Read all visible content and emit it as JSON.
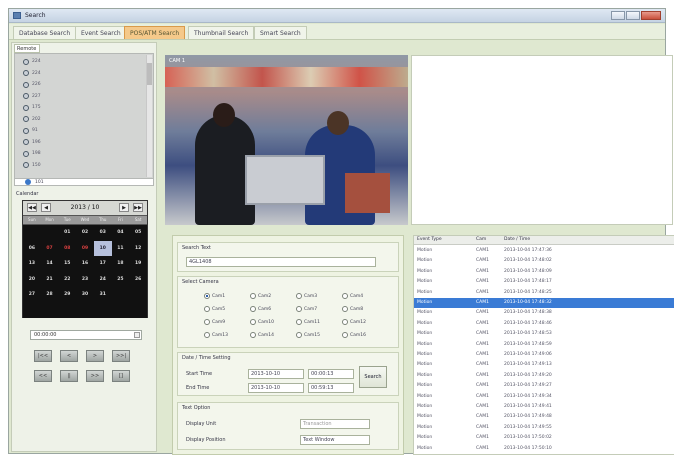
{
  "window": {
    "title": "Search"
  },
  "tabs": [
    {
      "label": "Database Search",
      "active": false
    },
    {
      "label": "Event Search",
      "active": false
    },
    {
      "label": "POS/ATM Search",
      "active": true
    },
    {
      "label": "Thumbnail Search",
      "active": false
    },
    {
      "label": "Smart Search",
      "active": false
    }
  ],
  "device_tab": "Remote",
  "devices": [
    "224",
    "224",
    "226",
    "227",
    "175",
    "202",
    "91",
    "196",
    "198",
    "150"
  ],
  "device_selected": "101",
  "calendar": {
    "label": "Calendar",
    "month": "2013 / 10",
    "weekdays": [
      "Sun",
      "Mon",
      "Tue",
      "Wed",
      "Thu",
      "Fri",
      "Sat"
    ],
    "days": [
      "",
      "",
      "01",
      "02",
      "03",
      "04",
      "05",
      "06",
      "07",
      "08",
      "09",
      "10",
      "11",
      "12",
      "13",
      "14",
      "15",
      "16",
      "17",
      "18",
      "19",
      "20",
      "21",
      "22",
      "23",
      "24",
      "25",
      "26",
      "27",
      "28",
      "29",
      "30",
      "31",
      "",
      ""
    ],
    "red_days": [
      "07",
      "08",
      "09"
    ],
    "selected_day": "10"
  },
  "time_field": "00:00:00",
  "playback_buttons": [
    "|<<",
    "<",
    ">",
    ">>|",
    "<<",
    "||",
    ">>",
    "[]"
  ],
  "video": {
    "label": "CAM 1"
  },
  "search": {
    "search_text_group": "Search Text",
    "search_text_value": "4GL1408",
    "select_camera_group": "Select Camera",
    "cameras": [
      "Cam1",
      "Cam2",
      "Cam3",
      "Cam4",
      "Cam5",
      "Cam6",
      "Cam7",
      "Cam8",
      "Cam9",
      "Cam10",
      "Cam11",
      "Cam12",
      "Cam13",
      "Cam14",
      "Cam15",
      "Cam16"
    ],
    "selected_camera": "Cam1",
    "datetime_group": "Date / Time Setting",
    "start_label": "Start Time",
    "start_date": "2013-10-10",
    "start_time": "00:00:13",
    "end_label": "End Time",
    "end_date": "2013-10-10",
    "end_time": "00:59:13",
    "search_button": "Search",
    "text_option_group": "Text Option",
    "display_unit_label": "Display Unit",
    "display_unit_value": "Transaction",
    "display_position_label": "Display Position",
    "display_position_value": "Text Window"
  },
  "results": {
    "headers": [
      "Event Type",
      "Cam",
      "Date / Time"
    ],
    "rows": [
      [
        "Motion",
        "CAM1",
        "2013-10-04 17:47:36"
      ],
      [
        "Motion",
        "CAM1",
        "2013-10-04 17:48:02"
      ],
      [
        "Motion",
        "CAM1",
        "2013-10-04 17:48:09"
      ],
      [
        "Motion",
        "CAM1",
        "2013-10-04 17:48:17"
      ],
      [
        "Motion",
        "CAM1",
        "2013-10-04 17:48:25"
      ],
      [
        "Motion",
        "CAM1",
        "2013-10-04 17:48:32"
      ],
      [
        "Motion",
        "CAM1",
        "2013-10-04 17:48:38"
      ],
      [
        "Motion",
        "CAM1",
        "2013-10-04 17:48:46"
      ],
      [
        "Motion",
        "CAM1",
        "2013-10-04 17:48:53"
      ],
      [
        "Motion",
        "CAM1",
        "2013-10-04 17:48:59"
      ],
      [
        "Motion",
        "CAM1",
        "2013-10-04 17:49:06"
      ],
      [
        "Motion",
        "CAM1",
        "2013-10-04 17:49:13"
      ],
      [
        "Motion",
        "CAM1",
        "2013-10-04 17:49:20"
      ],
      [
        "Motion",
        "CAM1",
        "2013-10-04 17:49:27"
      ],
      [
        "Motion",
        "CAM1",
        "2013-10-04 17:49:34"
      ],
      [
        "Motion",
        "CAM1",
        "2013-10-04 17:49:41"
      ],
      [
        "Motion",
        "CAM1",
        "2013-10-04 17:49:48"
      ],
      [
        "Motion",
        "CAM1",
        "2013-10-04 17:49:55"
      ],
      [
        "Motion",
        "CAM1",
        "2013-10-04 17:50:02"
      ],
      [
        "Motion",
        "CAM1",
        "2013-10-04 17:50:10"
      ]
    ],
    "selected_index": 5
  }
}
